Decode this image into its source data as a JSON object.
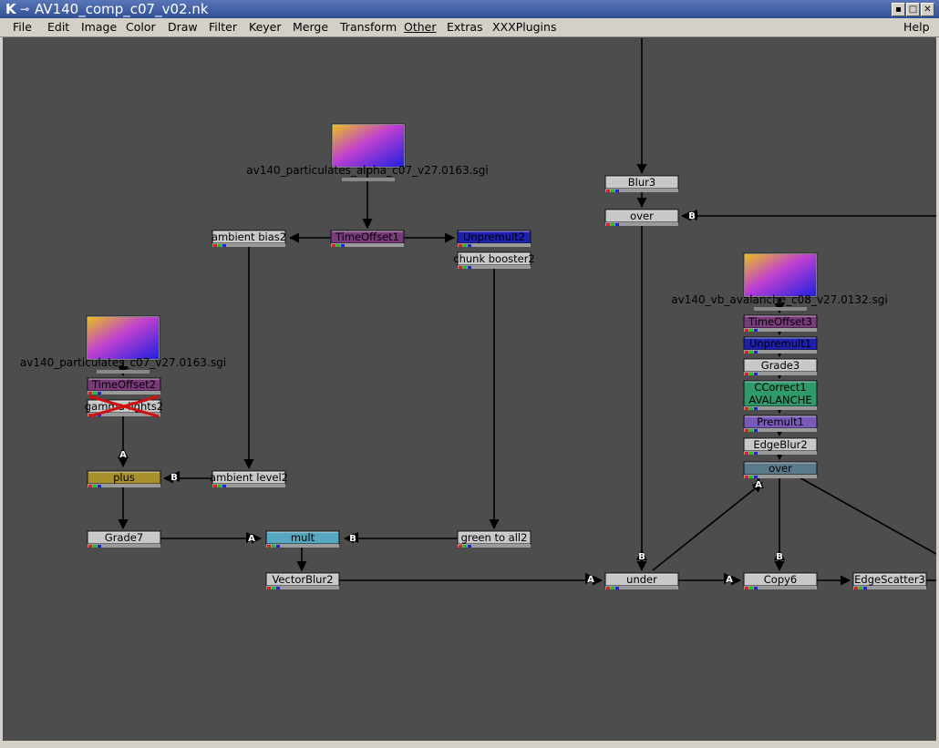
{
  "window": {
    "title": "AV140_comp_c07_v02.nk"
  },
  "menubar": {
    "items": [
      "File",
      "Edit",
      "Image",
      "Color",
      "Draw",
      "Filter",
      "Keyer",
      "Merge",
      "Transform",
      "Other",
      "Extras",
      "XXXPlugins",
      "Help"
    ]
  },
  "graph": {
    "read_nodes": [
      {
        "id": "read_alpha",
        "label": "av140_particulates_alpha_c07_v27.0163.sgi"
      },
      {
        "id": "read_part",
        "label": "av140_particulates_c07_v27.0163.sgi"
      },
      {
        "id": "read_aval",
        "label": "av140_vb_avalanche_c08_v27.0132.sgi"
      }
    ],
    "nodes": [
      {
        "id": "timeoffset1",
        "label": "TimeOffset1",
        "color": "#7a3a7c"
      },
      {
        "id": "ambient_bias2",
        "label": "ambient bias2",
        "color": "#c8c8c8"
      },
      {
        "id": "unpremult2",
        "label": "Unpremult2",
        "color": "#1f1fb0"
      },
      {
        "id": "chunk_booster2",
        "label": "chunk booster2",
        "color": "#c8c8c8"
      },
      {
        "id": "timeoffset2",
        "label": "TimeOffset2",
        "color": "#7a3a7c"
      },
      {
        "id": "gamma_lights2",
        "label": "gamma lights2",
        "color": "#c8c8c8"
      },
      {
        "id": "plus",
        "label": "plus",
        "color": "#a8902e"
      },
      {
        "id": "ambient_level2",
        "label": "ambient level2",
        "color": "#c8c8c8"
      },
      {
        "id": "grade7",
        "label": "Grade7",
        "color": "#c8c8c8"
      },
      {
        "id": "mult",
        "label": "mult",
        "color": "#55a8c0"
      },
      {
        "id": "green_to_all2",
        "label": "green to all2",
        "color": "#c8c8c8"
      },
      {
        "id": "vectorblur2",
        "label": "VectorBlur2",
        "color": "#c8c8c8"
      },
      {
        "id": "blur3",
        "label": "Blur3",
        "color": "#c8c8c8"
      },
      {
        "id": "over_top",
        "label": "over",
        "color": "#c8c8c8"
      },
      {
        "id": "timeoffset3",
        "label": "TimeOffset3",
        "color": "#7a3a7c"
      },
      {
        "id": "unpremult1",
        "label": "Unpremult1",
        "color": "#1f1fb0"
      },
      {
        "id": "grade3",
        "label": "Grade3",
        "color": "#c8c8c8"
      },
      {
        "id": "ccorrect1",
        "label": "CCorrect1",
        "label2": "AVALANCHE",
        "color": "#2f9a6c"
      },
      {
        "id": "premult1",
        "label": "Premult1",
        "color": "#7a5ab8"
      },
      {
        "id": "edgeblur2",
        "label": "EdgeBlur2",
        "color": "#c8c8c8"
      },
      {
        "id": "over_aval",
        "label": "over",
        "color": "#5a7a8c"
      },
      {
        "id": "under",
        "label": "under",
        "color": "#c8c8c8"
      },
      {
        "id": "copy6",
        "label": "Copy6",
        "color": "#c8c8c8"
      },
      {
        "id": "edgescatter3",
        "label": "EdgeScatter3",
        "color": "#c8c8c8"
      }
    ],
    "input_labels": {
      "a": "A",
      "b": "B"
    }
  }
}
